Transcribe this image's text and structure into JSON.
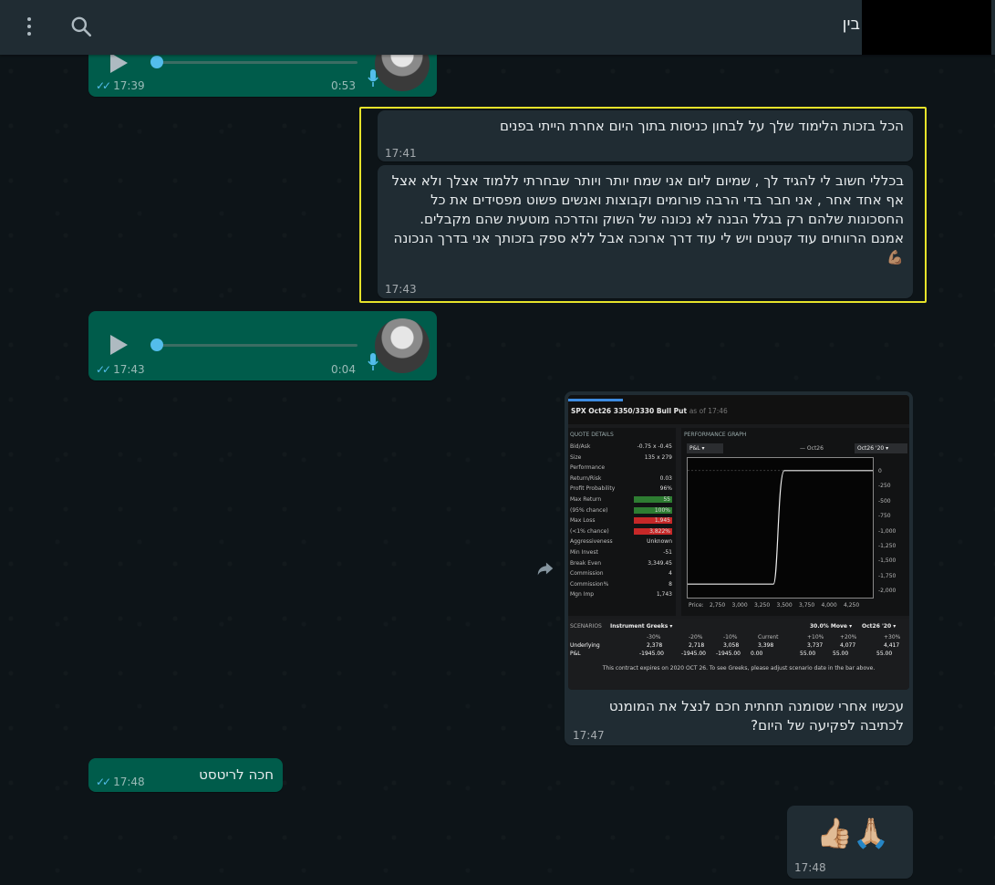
{
  "header": {
    "contact_name": "בין",
    "menu_icon": "more-vertical-icon",
    "search_icon": "search-icon"
  },
  "messages": {
    "voice1": {
      "duration": "0:53",
      "time": "17:39"
    },
    "text1": {
      "text": "הכל בזכות הלימוד שלך על לבחון כניסות בתוך היום אחרת הייתי בפנים",
      "time": "17:41"
    },
    "text2": {
      "text": "בכללי חשוב לי להגיד לך , שמיום ליום אני שמח יותר ויותר שבחרתי ללמוד אצלך ולא אצל אף אחד אחר , אני חבר בדי הרבה פורומים וקבוצות ואנשים פשוט מפסידים את כל החסכונות שלהם רק בגלל הבנה לא נכונה של השוק והדרכה מוטעית שהם מקבלים.\nאמנם הרווחים עוד קטנים ויש לי עוד דרך ארוכה אבל ללא ספק בזכותך אני בדרך הנכונה💪🏽",
      "time": "17:43"
    },
    "voice2": {
      "duration": "0:04",
      "time": "17:43"
    },
    "image_msg": {
      "caption": "עכשיו אחרי שסומנה תחתית חכם לנצל את המומנט לכתיבה לפקיעה של היום?",
      "time": "17:47"
    },
    "text3": {
      "text": "חכה לריטסט",
      "time": "17:48"
    },
    "emoji_msg": {
      "text": "👍🏼🙏🏼",
      "time": "17:48"
    }
  },
  "screenshot": {
    "title": "SPX Oct26 3350/3330 Bull Put",
    "as_of": "as of 17:46",
    "quote_header": "QUOTE DETAILS",
    "perf_header": "PERFORMANCE GRAPH",
    "pl_select": "P&L",
    "legend_a": "Oct26",
    "legend_b": "Oct26 '20",
    "quote_rows": [
      {
        "label": "Bid/Ask",
        "value": "-0.75 x -0.45"
      },
      {
        "label": "Size",
        "value": "135 x 279"
      },
      {
        "label": "Performance",
        "value": ""
      },
      {
        "label": "Return/Risk",
        "value": "0.03"
      },
      {
        "label": "Profit Probability",
        "value": "96%"
      },
      {
        "label": "Max Return",
        "value": "55"
      },
      {
        "label": "(95% chance)",
        "value": "100%"
      },
      {
        "label": "Max Loss",
        "value": "1,945"
      },
      {
        "label": "(<1% chance)",
        "value": "3,822%"
      },
      {
        "label": "Aggressiveness",
        "value": "Unknown"
      },
      {
        "label": "Min Invest",
        "value": "-51"
      },
      {
        "label": "Break Even",
        "value": "3,349.45"
      },
      {
        "label": "Commission",
        "value": "4"
      },
      {
        "label": "Commission%",
        "value": "8"
      },
      {
        "label": "Mgn Imp",
        "value": "1,743"
      }
    ],
    "y_ticks": [
      "0",
      "-250",
      "-500",
      "-750",
      "-1,000",
      "-1,250",
      "-1,500",
      "-1,750",
      "-2,000"
    ],
    "x_ticks": [
      "2,750",
      "3,000",
      "3,250",
      "3,500",
      "3,750",
      "4,000",
      "4,250"
    ],
    "x_label": "Price:",
    "y_label": "P&L",
    "scenarios_header": "SCENARIOS",
    "greeks_select": "Instrument Greeks",
    "move_label": "30.0% Move",
    "date_select": "Oct26 '20",
    "scenario_cols": [
      "-30%",
      "-20%",
      "-10%",
      "Current",
      "+10%",
      "+20%",
      "+30%"
    ],
    "underlying_label": "Underlying",
    "underlying_vals": [
      "2,378",
      "2,718",
      "3,058",
      "3,398",
      "3,737",
      "4,077",
      "4,417"
    ],
    "pl_label": "P&L",
    "pl_vals": [
      "-1945.00",
      "-1945.00",
      "-1945.00",
      "0.00",
      "55.00",
      "55.00",
      "55.00"
    ],
    "footnote": "This contract expires on 2020 OCT 26. To see Greeks, please adjust scenario date in the bar above."
  }
}
